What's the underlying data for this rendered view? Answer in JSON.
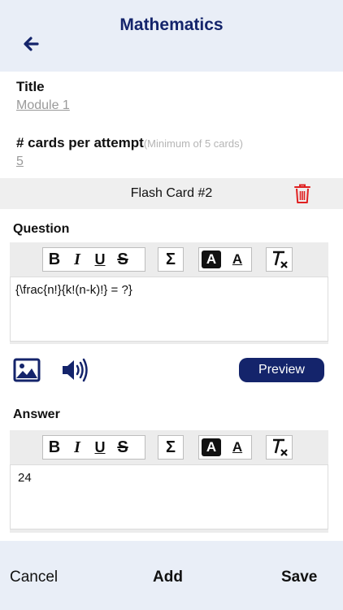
{
  "header": {
    "title": "Mathematics"
  },
  "form": {
    "title_label": "Title",
    "title_value": "Module 1",
    "cards_label": "# cards per attempt",
    "cards_hint": "(Minimum of 5 cards)",
    "cards_value": "5"
  },
  "card": {
    "title": "Flash Card #2"
  },
  "question": {
    "label": "Question",
    "content": "{\\frac{n!}{k!(n-k)!} = ?}",
    "preview_label": "Preview"
  },
  "answer": {
    "label": "Answer",
    "content": "24"
  },
  "toolbar": {
    "bold": "B",
    "italic": "I",
    "underline": "U",
    "strike": "S",
    "sigma": "Σ",
    "text_a": "A"
  },
  "footer": {
    "cancel": "Cancel",
    "add": "Add",
    "save": "Save"
  },
  "colors": {
    "accent": "#14246b",
    "header_bg": "#e9eef7",
    "trash": "#e02020"
  },
  "icons": [
    "back-arrow-icon",
    "trash-icon",
    "image-icon",
    "speaker-icon",
    "clear-format-icon"
  ]
}
